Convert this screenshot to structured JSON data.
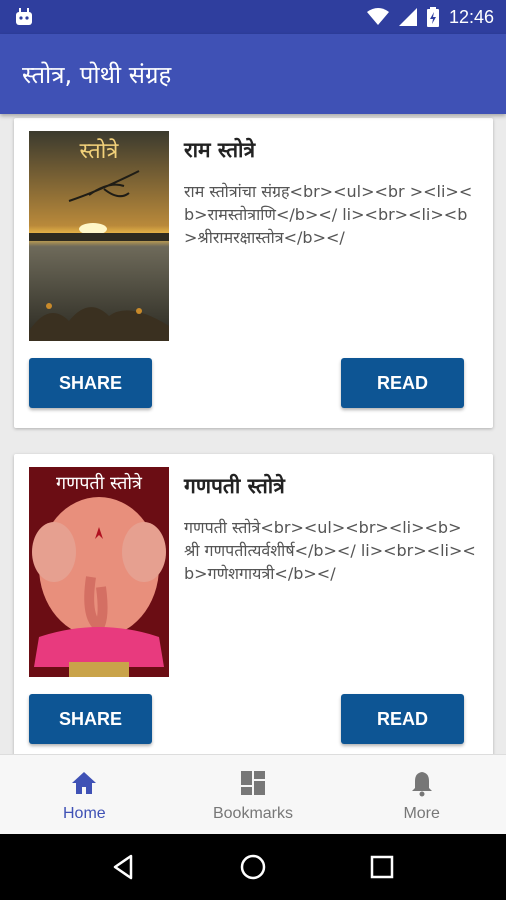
{
  "status_bar": {
    "time": "12:46"
  },
  "app_bar": {
    "title": "स्तोत्र, पोथी संग्रह"
  },
  "cards": [
    {
      "thumbnail_text": "स्तोत्रे",
      "title": "राम स्तोत्रे",
      "description": "राम स्तोत्रांचा संग्रह<br><ul><br ><li><b>रामस्तोत्राणि</b></ li><br><li><b>श्रीरामरक्षास्तोत्र</b></",
      "share_label": "SHARE",
      "read_label": "READ"
    },
    {
      "thumbnail_text": "गणपती स्तोत्रे",
      "title": "गणपती स्तोत्रे",
      "description": "गणपती स्तोत्रे<br><ul><br><li><b>श्री गणपतीत्यर्वशीर्ष</b></ li><br><li><b>गणेशगायत्री</b></",
      "share_label": "SHARE",
      "read_label": "READ"
    }
  ],
  "bottom_nav": [
    {
      "label": "Home",
      "icon": "home-icon",
      "active": true
    },
    {
      "label": "Bookmarks",
      "icon": "dashboard-icon",
      "active": false
    },
    {
      "label": "More",
      "icon": "bell-icon",
      "active": false
    }
  ],
  "colors": {
    "primary": "#3f51b5",
    "primary_dark": "#2f3e9e",
    "button": "#0d5594"
  }
}
